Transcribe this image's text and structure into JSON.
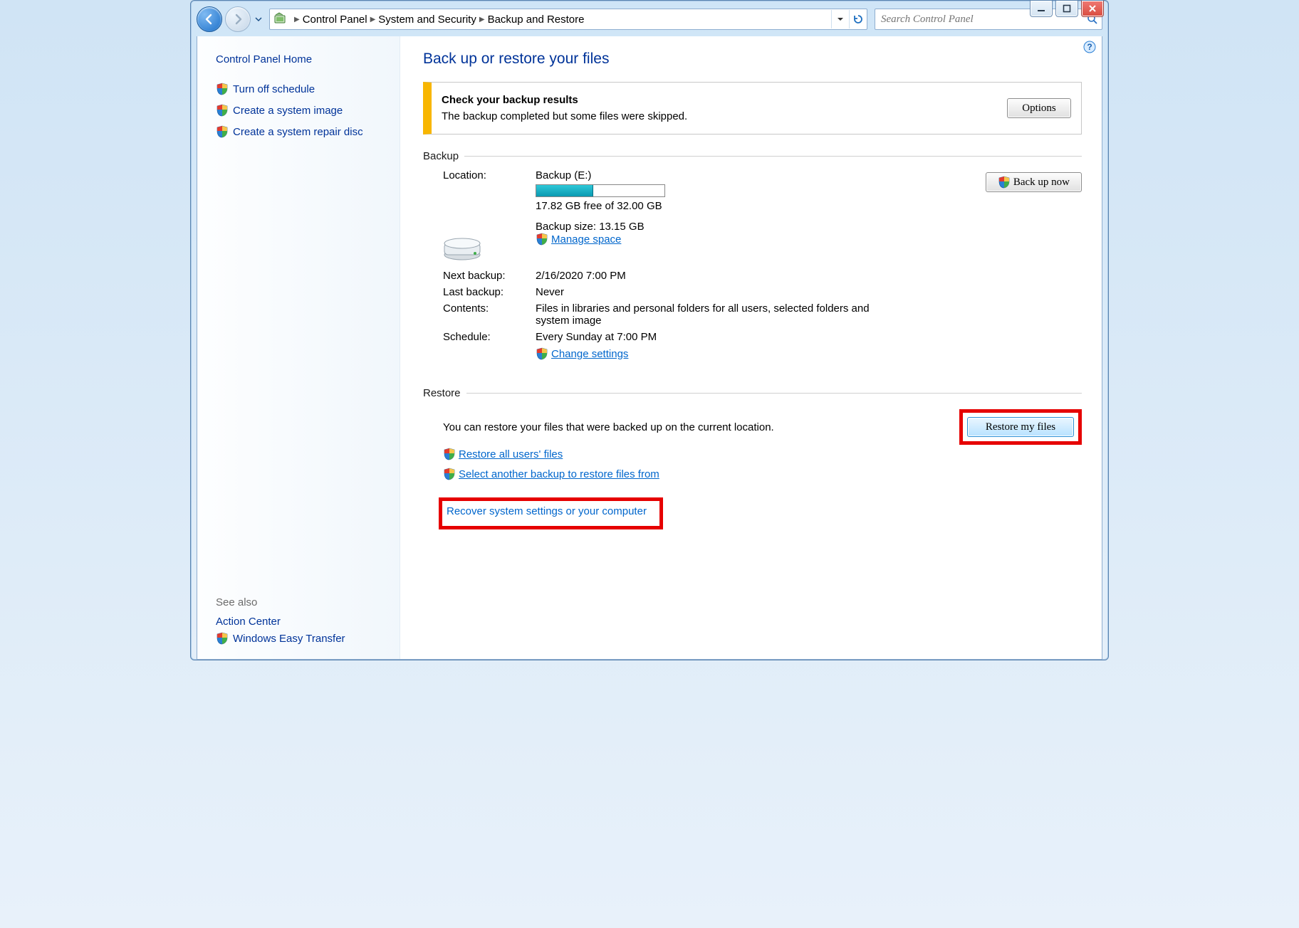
{
  "breadcrumbs": [
    "Control Panel",
    "System and Security",
    "Backup and Restore"
  ],
  "search": {
    "placeholder": "Search Control Panel"
  },
  "sidebar": {
    "home_label": "Control Panel Home",
    "links": [
      {
        "label": "Turn off schedule"
      },
      {
        "label": "Create a system image"
      },
      {
        "label": "Create a system repair disc"
      }
    ],
    "see_also_label": "See also",
    "see_also": [
      {
        "label": "Action Center",
        "shield": false
      },
      {
        "label": "Windows Easy Transfer",
        "shield": true
      }
    ]
  },
  "page_title": "Back up or restore your files",
  "notice": {
    "title": "Check your backup results",
    "body": "The backup completed but some files were skipped.",
    "options_label": "Options"
  },
  "backup": {
    "group_label": "Backup",
    "location_label": "Location:",
    "drive_name": "Backup (E:)",
    "capacity_text": "17.82 GB free of 32.00 GB",
    "capacity_used_pct": 44,
    "size_text": "Backup size: 13.15 GB",
    "manage_space": "Manage space",
    "backup_now_label": "Back up now",
    "next_backup_label": "Next backup:",
    "next_backup_value": "2/16/2020 7:00 PM",
    "last_backup_label": "Last backup:",
    "last_backup_value": "Never",
    "contents_label": "Contents:",
    "contents_value": "Files in libraries and personal folders for all users, selected folders and system image",
    "schedule_label": "Schedule:",
    "schedule_value": "Every Sunday at 7:00 PM",
    "change_settings": "Change settings"
  },
  "restore": {
    "group_label": "Restore",
    "intro": "You can restore your files that were backed up on the current location.",
    "restore_btn": "Restore my files",
    "restore_all": "Restore all users' files",
    "select_another": "Select another backup to restore files from",
    "recover": "Recover system settings or your computer"
  }
}
